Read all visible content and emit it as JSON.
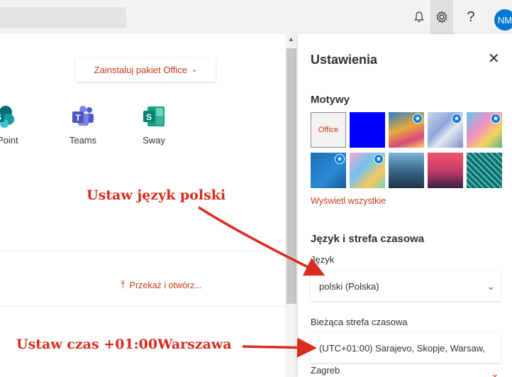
{
  "topbar": {
    "help_glyph": "?",
    "avatar_initials": "NM"
  },
  "main": {
    "install_label": "Zainstaluj pakiet Office",
    "apps": [
      {
        "label": "rePoint",
        "icon": "sharepoint-icon",
        "color": "#038387"
      },
      {
        "label": "Teams",
        "icon": "teams-icon",
        "color": "#4b53bc"
      },
      {
        "label": "Sway",
        "icon": "sway-icon",
        "color": "#008272"
      }
    ],
    "upload_label": "Przekaż i otwórz..."
  },
  "panel": {
    "title": "Ustawienia",
    "themes_title": "Motywy",
    "office_theme_label": "Office",
    "show_all_label": "Wyświetl wszystkie",
    "lang_section_title": "Język i strefa czasowa",
    "lang_label": "Język",
    "lang_value": "polski (Polska)",
    "tz_label": "Bieżąca strefa czasowa",
    "tz_value": "(UTC+01:00) Sarajevo, Skopje, Warsaw,",
    "tz_value_cont": "Zagreb"
  },
  "annotations": {
    "set_language": "Ustaw język polski",
    "set_timezone": "Ustaw czas +01:00Warszawa"
  },
  "colors": {
    "accent": "#c43e1c",
    "annotation": "#d72c1e",
    "avatar": "#0078d4"
  }
}
